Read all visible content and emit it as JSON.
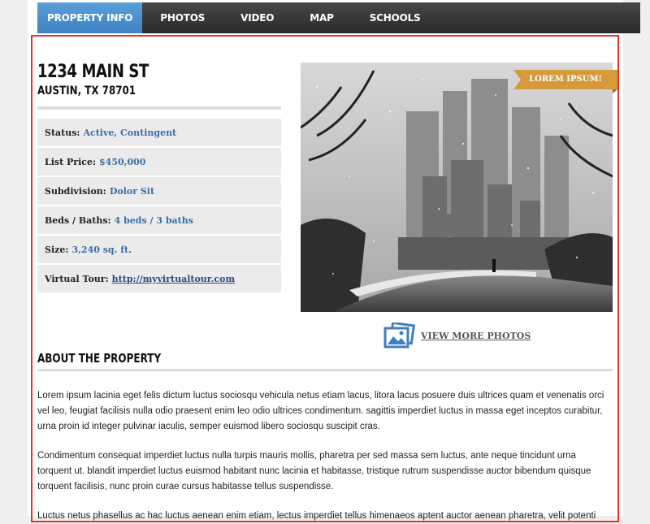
{
  "nav": {
    "tabs": [
      "PROPERTY INFO",
      "PHOTOS",
      "VIDEO",
      "MAP",
      "SCHOOLS"
    ],
    "active_index": 0
  },
  "property": {
    "street": "1234 MAIN ST",
    "city_line": "AUSTIN, TX 78701"
  },
  "details": [
    {
      "label": "Status:",
      "value": "Active, Contingent"
    },
    {
      "label": "List Price:",
      "value": "$450,000"
    },
    {
      "label": "Subdivision:",
      "value": "Dolor Sit"
    },
    {
      "label": "Beds / Baths:",
      "value": "4 beds / 3 baths"
    },
    {
      "label": "Size:",
      "value": "3,240 sq. ft."
    },
    {
      "label": "Virtual Tour:",
      "value": "http://myvirtualtour.com"
    }
  ],
  "photo": {
    "banner": "LOREM IPSUM!",
    "more_photos": "VIEW MORE PHOTOS"
  },
  "about": {
    "heading": "ABOUT THE PROPERTY",
    "paragraphs": [
      "Lorem ipsum lacinia eget felis dictum luctus sociosqu vehicula netus etiam lacus, litora lacus posuere duis ultrices quam et venenatis orci vel leo, feugiat facilisis nulla odio praesent enim leo odio ultrices condimentum. sagittis imperdiet luctus in massa eget inceptos curabitur, urna proin id integer pulvinar iaculis, semper euismod libero sociosqu suscipit cras.",
      "Condimentum consequat imperdiet luctus nulla turpis mauris mollis, pharetra per sed massa sem luctus, ante neque tincidunt urna torquent ut. blandit imperdiet luctus euismod habitant nunc lacinia et habitasse, tristique rutrum suspendisse auctor bibendum quisque torquent facilisis, nunc proin curae cursus habitasse tellus suspendisse.",
      "Luctus netus phasellus ac hac luctus aenean enim etiam, lectus imperdiet tellus himenaeos aptent auctor aenean pharetra, velit potenti"
    ]
  },
  "colors": {
    "nav_active": "#4a90d0",
    "link": "#3a6ea5",
    "banner": "#d59a3a",
    "highlight_border": "#e6322a"
  }
}
